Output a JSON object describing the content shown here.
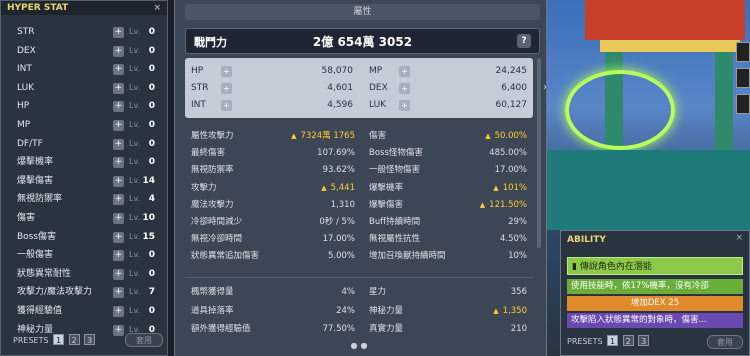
{
  "hyper_stat": {
    "title": "HYPER STAT",
    "close": "×",
    "lv_label": "Lv.",
    "plus": "+",
    "rows": [
      {
        "name": "STR",
        "level": "0"
      },
      {
        "name": "DEX",
        "level": "0"
      },
      {
        "name": "INT",
        "level": "0"
      },
      {
        "name": "LUK",
        "level": "0"
      },
      {
        "name": "HP",
        "level": "0"
      },
      {
        "name": "MP",
        "level": "0"
      },
      {
        "name": "DF/TF",
        "level": "0"
      },
      {
        "name": "爆擊機率",
        "level": "0"
      },
      {
        "name": "爆擊傷害",
        "level": "14"
      },
      {
        "name": "無視防禦率",
        "level": "4"
      },
      {
        "name": "傷害",
        "level": "10"
      },
      {
        "name": "Boss傷害",
        "level": "15"
      },
      {
        "name": "一般傷害",
        "level": "0"
      },
      {
        "name": "狀態異常耐性",
        "level": "0"
      },
      {
        "name": "攻擊力/魔法攻擊力",
        "level": "7"
      },
      {
        "name": "獲得經驗值",
        "level": "0"
      },
      {
        "name": "神秘力量",
        "level": "0"
      }
    ],
    "presets_label": "PRESETS",
    "presets": [
      "1",
      "2",
      "3"
    ],
    "apply_label": "套用"
  },
  "stats": {
    "title": "屬性",
    "power_label": "戰鬥力",
    "power_value": "2億 654萬 3052",
    "help": "?",
    "expand": "›",
    "basic": {
      "left": [
        {
          "name": "HP",
          "value": "58,070"
        },
        {
          "name": "STR",
          "value": "4,601"
        },
        {
          "name": "INT",
          "value": "4,596"
        }
      ],
      "right": [
        {
          "name": "MP",
          "value": "24,245"
        },
        {
          "name": "DEX",
          "value": "6,400"
        },
        {
          "name": "LUK",
          "value": "60,127"
        }
      ]
    },
    "detail_left": [
      {
        "name": "屬性攻擊力",
        "value": "7324萬 1765",
        "gold": true
      },
      {
        "name": "最終傷害",
        "value": "107.69%"
      },
      {
        "name": "無視防禦率",
        "value": "93.62%"
      },
      {
        "name": "攻擊力",
        "value": "5,441",
        "gold": true
      },
      {
        "name": "魔法攻擊力",
        "value": "1,310"
      },
      {
        "name": "冷卻時間減少",
        "value": "0秒 / 5%"
      },
      {
        "name": "無視冷卻時間",
        "value": "17.00%"
      },
      {
        "name": "狀態異常追加傷害",
        "value": "5.00%"
      }
    ],
    "detail_right": [
      {
        "name": "傷害",
        "value": "50.00%",
        "gold": true
      },
      {
        "name": "Boss怪物傷害",
        "value": "485.00%"
      },
      {
        "name": "一般怪物傷害",
        "value": "17.00%"
      },
      {
        "name": "爆擊機率",
        "value": "101%",
        "gold": true
      },
      {
        "name": "爆擊傷害",
        "value": "121.50%",
        "gold": true
      },
      {
        "name": "Buff持續時間",
        "value": "29%"
      },
      {
        "name": "無視屬性抗性",
        "value": "4.50%"
      },
      {
        "name": "增加召喚獸持續時間",
        "value": "10%"
      }
    ],
    "bottom_left": [
      {
        "name": "楓幣獲得量",
        "value": "4%"
      },
      {
        "name": "道具掉落率",
        "value": "24%"
      },
      {
        "name": "額外獲得經驗值",
        "value": "77.50%"
      }
    ],
    "bottom_right": [
      {
        "name": "星力",
        "value": "356"
      },
      {
        "name": "神秘力量",
        "value": "1,350",
        "gold": true
      },
      {
        "name": "真實力量",
        "value": "210"
      }
    ],
    "page_dots": "●●"
  },
  "ability": {
    "title": "ABILITY",
    "close": "×",
    "rank": "傳說角色內在潛能",
    "lines": [
      "使用技能時，依17%機率，沒有冷卻",
      "增加DEX 25",
      "攻擊陷入狀態異常的對象時，傷害..."
    ],
    "presets_label": "PRESETS",
    "presets": [
      "1",
      "2",
      "3"
    ],
    "apply_label": "套用"
  }
}
